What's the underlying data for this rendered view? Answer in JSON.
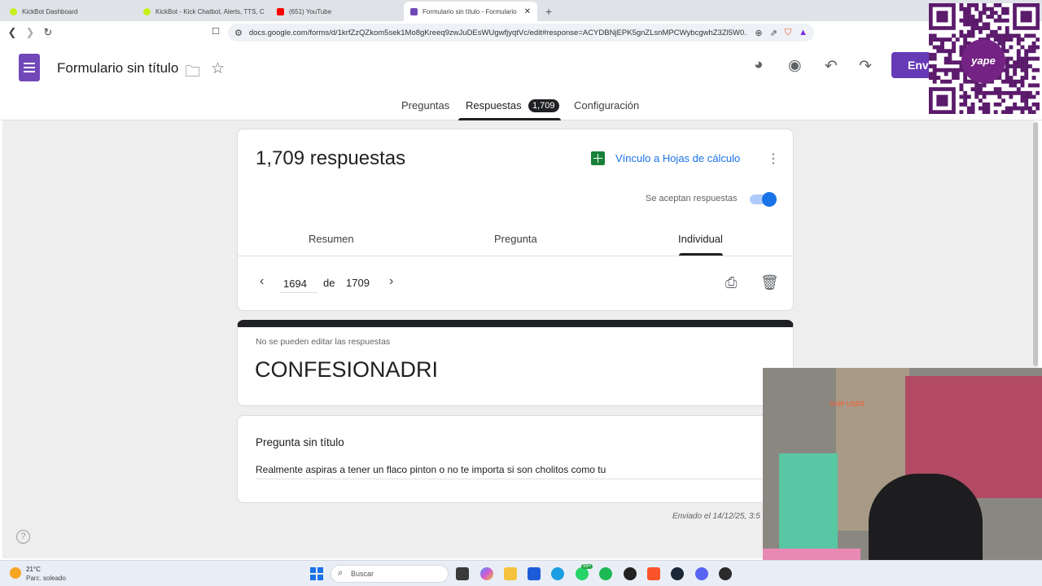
{
  "browser": {
    "tabs": [
      {
        "label": "KickBot Dashboard",
        "active": false,
        "favicon_color": "#c6f01b"
      },
      {
        "label": "KickBot - Kick Chatbot, Alerts, TTS, Cr",
        "active": false,
        "favicon_color": "#c6f01b"
      },
      {
        "label": "(651) YouTube",
        "active": false,
        "favicon_color": "#ff0000"
      },
      {
        "label": "Formulario sin título - Formulario",
        "active": true,
        "favicon_color": "#7248b9"
      }
    ],
    "url": "docs.google.com/forms/d/1krfZzQZkom5sek1Mo8gKreeq9zwJuDEsWUgwfjyqtVc/edit#response=ACYDBNjEPK5gnZLsnMPCWybcgwhZ3Zl5W0..."
  },
  "form": {
    "title": "Formulario sin título",
    "send_label": "Env",
    "tabs": [
      "Preguntas",
      "Respuestas",
      "Configuración"
    ],
    "response_badge": "1,709"
  },
  "summary": {
    "count_text": "1,709 respuestas",
    "sheets_link": "Vínculo a Hojas de cálculo",
    "accepting_label": "Se aceptan respuestas",
    "accepting": true,
    "subtabs": [
      "Resumen",
      "Pregunta",
      "Individual"
    ],
    "current": "1694",
    "of_label": "de",
    "total": "1709"
  },
  "response": {
    "no_edit_note": "No se pueden editar las respuestas",
    "title": "CONFESIONADRI",
    "question": "Pregunta sin título",
    "answer": "Realmente aspiras a tener un flaco pinton o no te importa si son cholitos como tu",
    "sent": "Enviado el 14/12/25, 3:5"
  },
  "overlays": {
    "qr_brand": "yape",
    "webcam_caption": "SHIP USER"
  },
  "taskbar": {
    "temperature": "21°C",
    "weather": "Parc. soleado",
    "search_placeholder": "Buscar",
    "whatsapp_badge": "99+"
  },
  "colors": {
    "forms_purple": "#673ab7",
    "link_blue": "#1a73e8",
    "sheets_green": "#188038"
  }
}
